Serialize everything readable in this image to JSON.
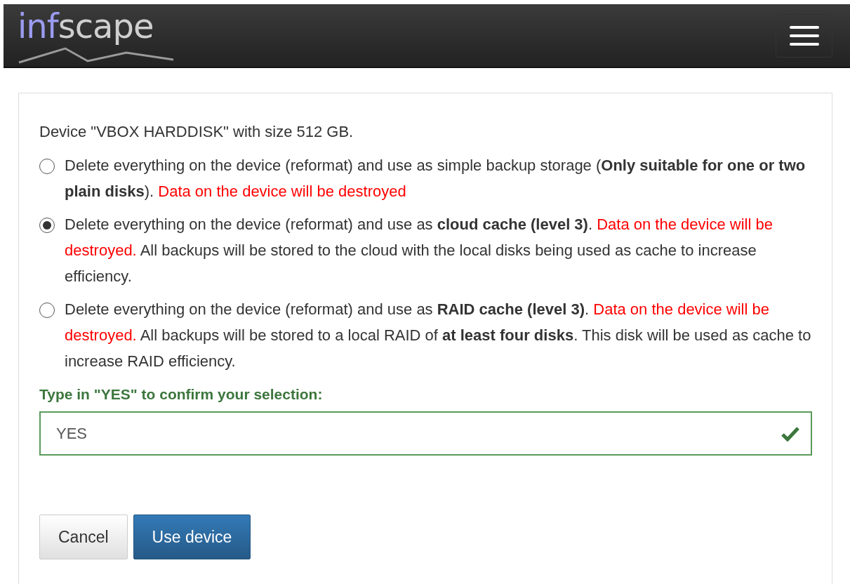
{
  "navbar": {
    "logo": [
      {
        "text": "inf",
        "kind": "accent"
      },
      {
        "text": "scape",
        "kind": "plain"
      }
    ]
  },
  "panel": {
    "device_line": "Device \"VBOX HARDDISK\" with size 512 GB.",
    "options": [
      {
        "selected": false,
        "segments": [
          {
            "kind": "plain",
            "text": "Delete everything on the device (reformat) and use as simple backup storage ("
          },
          {
            "kind": "bold",
            "text": "Only suitable for one or two plain disks"
          },
          {
            "kind": "plain",
            "text": "). "
          },
          {
            "kind": "danger",
            "text": "Data on the device will be destroyed"
          }
        ]
      },
      {
        "selected": true,
        "segments": [
          {
            "kind": "plain",
            "text": "Delete everything on the device (reformat) and use as "
          },
          {
            "kind": "bold",
            "text": "cloud cache (level 3)"
          },
          {
            "kind": "plain",
            "text": ". "
          },
          {
            "kind": "danger",
            "text": "Data on the device will be destroyed."
          },
          {
            "kind": "plain",
            "text": " All backups will be stored to the cloud with the local disks being used as cache to increase efficiency."
          }
        ]
      },
      {
        "selected": false,
        "segments": [
          {
            "kind": "plain",
            "text": "Delete everything on the device (reformat) and use as "
          },
          {
            "kind": "bold",
            "text": "RAID cache (level 3)"
          },
          {
            "kind": "plain",
            "text": ". "
          },
          {
            "kind": "danger",
            "text": "Data on the device will be destroyed."
          },
          {
            "kind": "plain",
            "text": " All backups will be stored to a local RAID of "
          },
          {
            "kind": "bold",
            "text": "at least four disks"
          },
          {
            "kind": "plain",
            "text": ". This disk will be used as cache to increase RAID efficiency."
          }
        ]
      }
    ],
    "confirm": {
      "label": "Type in \"YES\" to confirm your selection:",
      "value": "YES",
      "valid": true
    },
    "buttons": [
      {
        "label": "Cancel",
        "kind": "default"
      },
      {
        "label": "Use device",
        "kind": "primary"
      }
    ]
  }
}
